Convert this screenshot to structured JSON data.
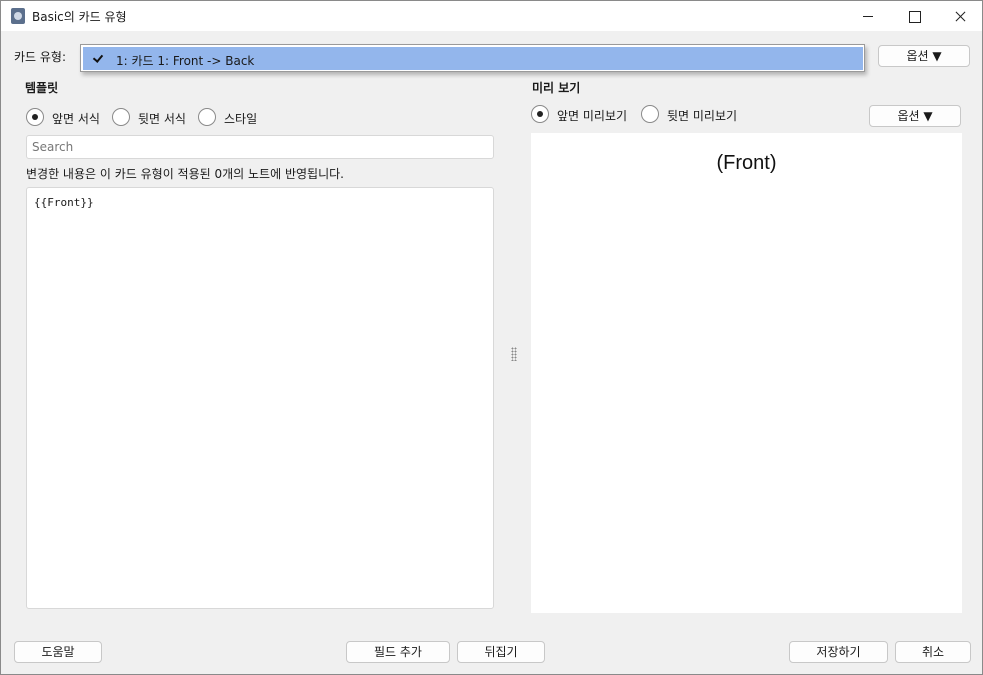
{
  "window": {
    "title": "Basic의 카드 유형"
  },
  "card_type": {
    "label": "카드 유형:",
    "options": [
      "1: 카드 1: Front -> Back"
    ],
    "selected_index": 0,
    "options_button": "옵션 ▼"
  },
  "template": {
    "heading": "템플릿",
    "radios": [
      {
        "label": "앞면 서식",
        "checked": true
      },
      {
        "label": "뒷면 서식",
        "checked": false
      },
      {
        "label": "스타일",
        "checked": false
      }
    ],
    "search_placeholder": "Search",
    "notice": "변경한 내용은 이 카드 유형이 적용된 0개의 노트에 반영됩니다.",
    "editor_content": "{{Front}}"
  },
  "preview": {
    "heading": "미리 보기",
    "radios": [
      {
        "label": "앞면 미리보기",
        "checked": true
      },
      {
        "label": "뒷면 미리보기",
        "checked": false
      }
    ],
    "options_button": "옵션 ▼",
    "rendered_text": "(Front)"
  },
  "footer": {
    "help": "도움말",
    "add_field": "필드 추가",
    "flip": "뒤집기",
    "save": "저장하기",
    "cancel": "취소"
  }
}
